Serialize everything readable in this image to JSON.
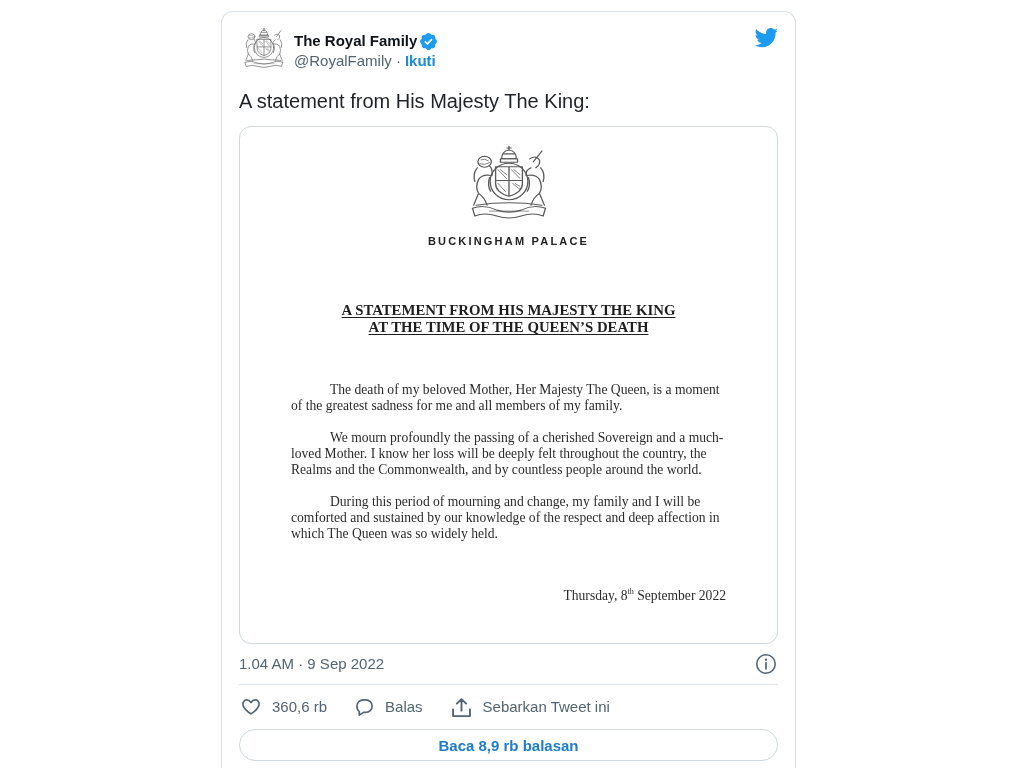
{
  "tweet": {
    "author": {
      "name": "The Royal Family",
      "verified": true,
      "handle": "@RoyalFamily ·",
      "follow_link": "Ikuti"
    },
    "text": "A statement from His Majesty The King:",
    "document": {
      "letterhead": "BUCKINGHAM PALACE",
      "heading_lines": [
        "A STATEMENT FROM HIS MAJESTY THE KING",
        "AT THE TIME OF THE QUEEN’S DEATH"
      ],
      "paragraphs": [
        "The death of my beloved Mother, Her Majesty The Queen, is a moment of the greatest sadness for me and all members of my family.",
        "We mourn profoundly the passing of a cherished Sovereign and a much-loved Mother. I know her loss will be deeply felt throughout the country, the Realms and the Commonwealth, and by countless people around the world.",
        "During this period of mourning and change, my family and I will be comforted and sustained by our knowledge of the respect and deep affection in which The Queen was so widely held."
      ],
      "date": "Thursday, 8$^{th}$ September 2022"
    },
    "timestamp": "1.04 AM · 9 Sep 2022",
    "actions": [
      {
        "kind": "like",
        "label": "360,6 rb"
      },
      {
        "kind": "reply",
        "label": "Balas"
      },
      {
        "kind": "share",
        "label": "Sebarkan Tweet ini"
      }
    ],
    "replies_button": "Baca 8,9 rb balasan"
  }
}
